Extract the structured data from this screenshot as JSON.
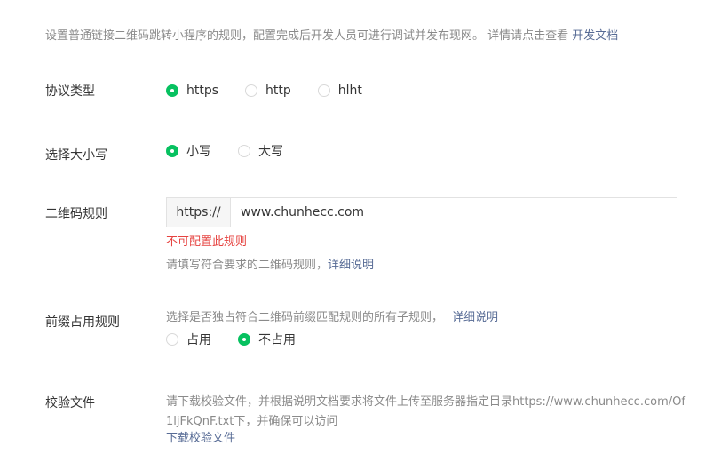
{
  "intro": {
    "text": "设置普通链接二维码跳转小程序的规则，配置完成后开发人员可进行调试并发布现网。 详情请点击查看 ",
    "link": "开发文档"
  },
  "protocol": {
    "label": "协议类型",
    "options": [
      "https",
      "http",
      "hlht"
    ],
    "selected": "https"
  },
  "case": {
    "label": "选择大小写",
    "options": [
      "小写",
      "大写"
    ],
    "selected": "小写"
  },
  "qr_rule": {
    "label": "二维码规则",
    "prefix": "https://",
    "value": "www.chunhecc.com",
    "error": "不可配置此规则",
    "hint": "请填写符合要求的二维码规则，",
    "hint_link": "详细说明"
  },
  "prefix_rule": {
    "label": "前缀占用规则",
    "hint": "选择是否独占符合二维码前缀匹配规则的所有子规则，",
    "hint_link": "详细说明",
    "options": [
      "占用",
      "不占用"
    ],
    "selected": "不占用"
  },
  "verify_file": {
    "label": "校验文件",
    "hint": "请下载校验文件，并根据说明文档要求将文件上传至服务器指定目录https://www.chunhecc.com/Of1ljFkQnF.txt下，并确保可以访问",
    "download_link": "下载校验文件"
  },
  "colors": {
    "accent": "#07c160",
    "link": "#576b95",
    "error": "#e64340",
    "hint": "#8a8a8a"
  }
}
